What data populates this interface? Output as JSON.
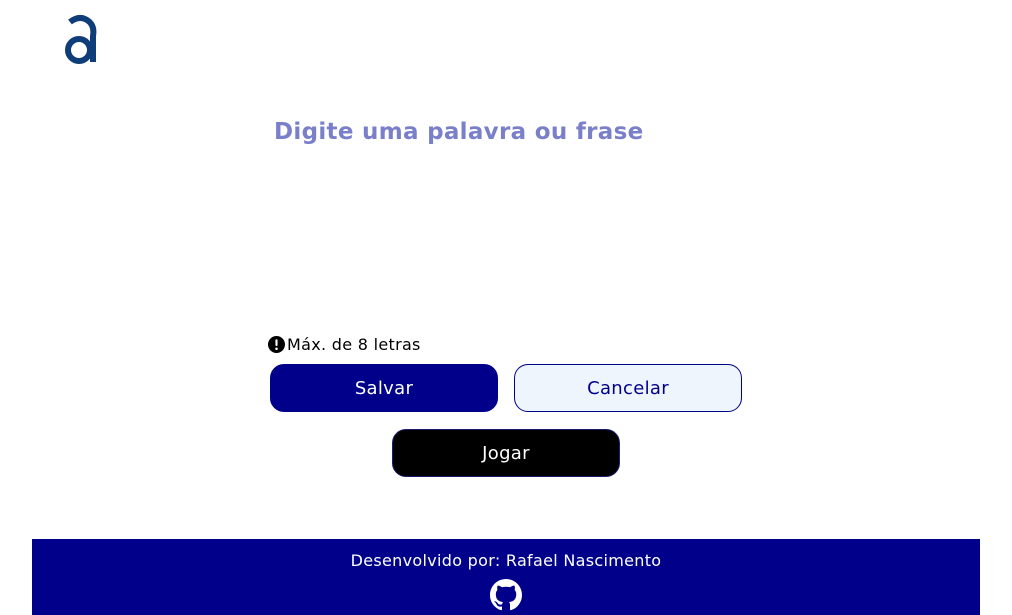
{
  "logo": {
    "icon": "alura-a-logo",
    "color": "#0f3d7a"
  },
  "input": {
    "placeholder": "Digite uma palavra ou frase",
    "value": ""
  },
  "hint": {
    "icon": "exclamation-circle-icon",
    "text": "Máx. de 8 letras"
  },
  "buttons": {
    "save_label": "Salvar",
    "cancel_label": "Cancelar",
    "play_label": "Jogar"
  },
  "footer": {
    "text": "Desenvolvido por: Rafael Nascimento",
    "icon": "github-icon"
  },
  "colors": {
    "primary": "#00008b",
    "placeholder": "#7a7fc9",
    "cancel_bg": "#eef5fc",
    "play_bg": "#000000"
  }
}
